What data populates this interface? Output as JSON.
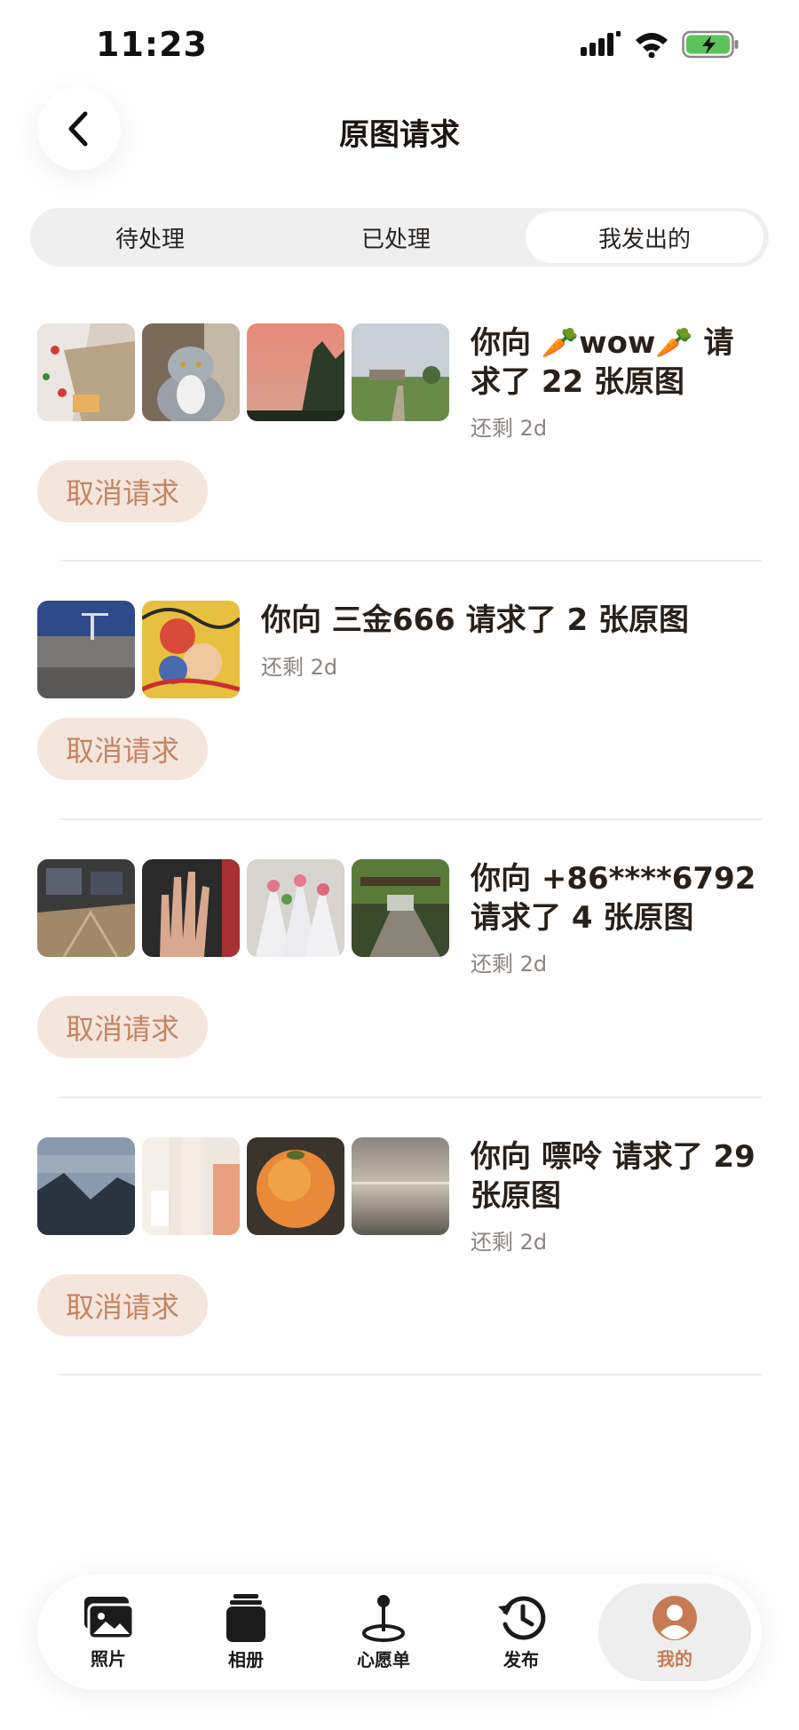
{
  "status": {
    "time": "11:23"
  },
  "header": {
    "title": "原图请求"
  },
  "tabs": [
    {
      "label": "待处理"
    },
    {
      "label": "已处理"
    },
    {
      "label": "我发出的"
    }
  ],
  "requests": [
    {
      "title": "你向 🥕wow🥕 请求了 22 张原图",
      "title_lines": [
        "你向 🥕wow🥕 请",
        "求了 22 张原图"
      ],
      "remaining": "还剩 2d",
      "cancel_label": "取消请求"
    },
    {
      "title": "你向 三金666 请求了 2 张原图",
      "title_lines": [
        "你向 三金666 请求了 2 张原图"
      ],
      "remaining": "还剩 2d",
      "cancel_label": "取消请求"
    },
    {
      "title": "你向 +86****6792 请求了 4 张原图",
      "title_lines": [
        "你向 +86****6792",
        "请求了 4 张原图"
      ],
      "remaining": "还剩 2d",
      "cancel_label": "取消请求"
    },
    {
      "title": "你向 嘌呤 请求了 29 张原图",
      "title_lines": [
        "你向 嘌呤 请求了 29",
        "张原图"
      ],
      "remaining": "还剩 2d",
      "cancel_label": "取消请求"
    }
  ],
  "nav": [
    {
      "label": "照片",
      "icon": "photos-icon"
    },
    {
      "label": "相册",
      "icon": "album-icon"
    },
    {
      "label": "心愿单",
      "icon": "wishlist-pin-icon"
    },
    {
      "label": "发布",
      "icon": "history-icon"
    },
    {
      "label": "我的",
      "icon": "profile-icon",
      "active": true
    }
  ],
  "colors": {
    "accent": "#c67b54",
    "cancel_bg": "#f5e6dd",
    "tab_bg": "#efefef"
  }
}
